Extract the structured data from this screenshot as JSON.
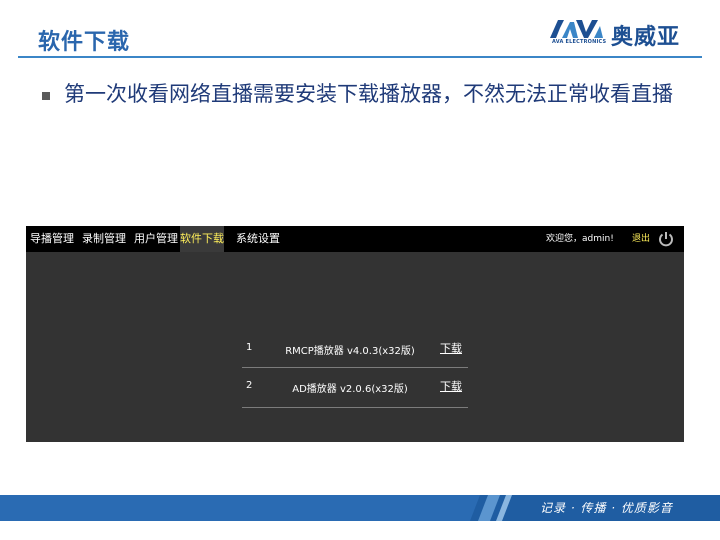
{
  "slide": {
    "title": "软件下载",
    "bullet": "第一次收看网络直播需要安装下载播放器，不然无法正常收看直播"
  },
  "logo": {
    "mark_text": "AVA",
    "sub_text": "AVA ELECTRONICS",
    "cn_name": "奥威亚"
  },
  "app": {
    "nav": [
      {
        "label": "导播管理",
        "active": false
      },
      {
        "label": "录制管理",
        "active": false
      },
      {
        "label": "用户管理",
        "active": false
      },
      {
        "label": "软件下载",
        "active": true
      },
      {
        "label": "系统设置",
        "active": false
      }
    ],
    "welcome": "欢迎您，admin!",
    "logout": "退出",
    "software": [
      {
        "num": "1",
        "name": "RMCP播放器 v4.0.3(x32版)",
        "action": "下载"
      },
      {
        "num": "2",
        "name": "AD播放器 v2.0.6(x32版)",
        "action": "下载"
      }
    ]
  },
  "footer": {
    "slogan": "记录 · 传播 · 优质影音"
  },
  "colors": {
    "title": "#2a66ad",
    "accent": "#3b86c7",
    "active_tab": "#ffef5a",
    "footer": "#1f5da2"
  }
}
